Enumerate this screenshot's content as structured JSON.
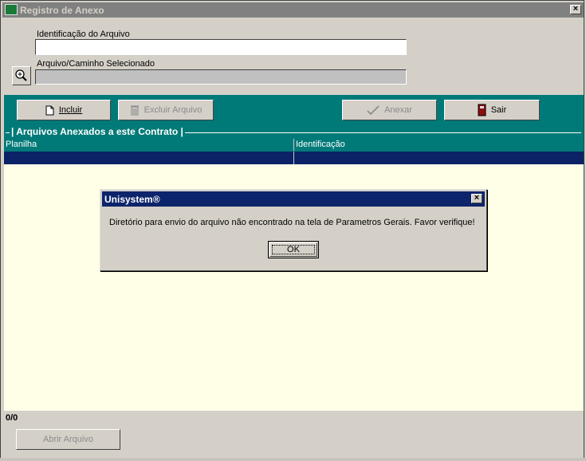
{
  "window": {
    "title": "Registro de Anexo",
    "close_glyph": "×"
  },
  "form": {
    "identification_label": "Identificação do Arquivo",
    "identification_value": "",
    "path_label": "Arquivo/Caminho Selecionado",
    "path_value": ""
  },
  "toolbar": {
    "include_label": "Incluir",
    "delete_label": "Excluir Arquivo",
    "attach_label": "Anexar",
    "exit_label": "Sair"
  },
  "attachments": {
    "group_title": "| Arquivos Anexados a este Contrato |",
    "columns": [
      "Planilha",
      "Identificação"
    ]
  },
  "status": {
    "count": "0/0"
  },
  "footer": {
    "open_file_label": "Abrir Arquivo"
  },
  "dialog": {
    "title": "Unisystem®",
    "message": "Diretório para envio do arquivo não encontrado na tela de Parametros Gerais. Favor verifique!",
    "ok_label": "OK",
    "close_glyph": "×"
  },
  "colors": {
    "teal": "#007a78",
    "title_active": "#0c246b",
    "title_inactive": "#808080",
    "grid_background": "#ffffe8",
    "selection": "#0c2266"
  },
  "icons": [
    "app-icon",
    "close-icon",
    "magnifier-icon",
    "document-icon",
    "trash-icon",
    "checkmark-icon",
    "exit-door-icon"
  ]
}
